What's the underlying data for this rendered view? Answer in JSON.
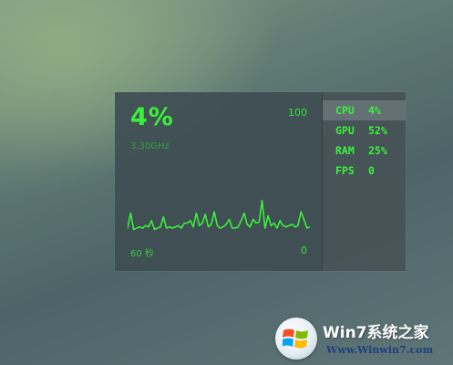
{
  "cpu_widget": {
    "usage_percent": "4%",
    "frequency": "3.30GHz",
    "scale_max": "100",
    "scale_min": "0",
    "time_window": "60 秒",
    "line_color": "#3bf03b",
    "graph_samples": [
      8,
      20,
      7,
      8,
      9,
      8,
      10,
      9,
      14,
      7,
      8,
      9,
      17,
      8,
      9,
      8,
      9,
      10,
      8,
      12,
      12,
      14,
      9,
      20,
      10,
      12,
      19,
      9,
      11,
      21,
      10,
      8,
      9,
      11,
      15,
      8,
      8,
      9,
      14,
      20,
      11,
      9,
      15,
      12,
      13,
      30,
      8,
      18,
      10,
      12,
      8,
      14,
      10,
      9,
      10,
      11,
      9,
      10,
      21,
      15,
      8,
      9
    ]
  },
  "stats": [
    {
      "label": "CPU",
      "value": "4%",
      "selected": true
    },
    {
      "label": "GPU",
      "value": "52%",
      "selected": false
    },
    {
      "label": "RAM",
      "value": "25%",
      "selected": false
    },
    {
      "label": "FPS",
      "value": "0",
      "selected": false
    }
  ],
  "watermark": {
    "brand": "Win7系统之家",
    "site": "Www.Winwin7.com",
    "icon": "windows-logo-icon"
  }
}
